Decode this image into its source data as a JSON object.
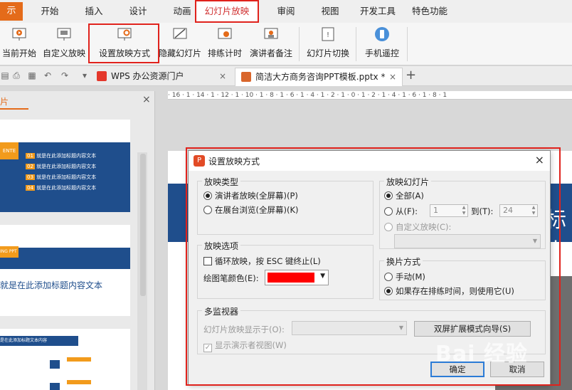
{
  "menu": {
    "file_label": "示",
    "tabs": [
      "开始",
      "插入",
      "设计",
      "动画",
      "幻灯片放映",
      "审阅",
      "视图",
      "开发工具",
      "特色功能"
    ],
    "active_tab": "幻灯片放映"
  },
  "ribbon": {
    "buttons": [
      "当前开始",
      "自定义放映",
      "设置放映方式",
      "隐藏幻灯片",
      "排练计时",
      "演讲者备注",
      "幻灯片切换",
      "手机遥控"
    ]
  },
  "docbar": {
    "tab_portal": "WPS 办公资源门户",
    "tab_doc": "简洁大方商务咨询PPT模板.pptx *",
    "new_tab": "+"
  },
  "leftpane": {
    "header": "片",
    "slide1": {
      "tag": "ENTE",
      "items": [
        {
          "num": "01",
          "text": "就是在此添加标题内容文本"
        },
        {
          "num": "02",
          "text": "就是在此添加标题内容文本"
        },
        {
          "num": "03",
          "text": "就是在此添加标题内容文本"
        },
        {
          "num": "04",
          "text": "就是在此添加标题内容文本"
        }
      ]
    },
    "slide2": {
      "tag": "ING PPT",
      "text": "就是在此添加标题内容文本"
    },
    "slide3": {
      "text": "是在此添加标题文本内容"
    }
  },
  "ruler": {
    "ticks": "· 16 · 1 · 14 · 1 · 12 · 1 · 10 · 1 · 8 · 1 · 6 · 1 · 4 · 1 · 2 · 1 · 0 · 1 · 2 · 1 · 4 · 1 · 6 · 1 · 8 · 1"
  },
  "canvas": {
    "text_fragment": "标内"
  },
  "dialog": {
    "title": "设置放映方式",
    "show_type": {
      "label": "放映类型",
      "opt_presenter": "演讲者放映(全屏幕)(P)",
      "opt_kiosk": "在展台浏览(全屏幕)(K)"
    },
    "show_options": {
      "label": "放映选项",
      "loop": "循环放映，按 ESC 键终止(L)",
      "pen_color_label": "绘图笔颜色(E):",
      "pen_color": "#ff0000"
    },
    "slides": {
      "label": "放映幻灯片",
      "all": "全部(A)",
      "from": "从(F):",
      "from_value": "1",
      "to": "到(T):",
      "to_value": "24",
      "custom": "自定义放映(C):"
    },
    "advance": {
      "label": "换片方式",
      "manual": "手动(M)",
      "timings": "如果存在排练时间，则使用它(U)"
    },
    "monitors": {
      "label": "多监视器",
      "display_on": "幻灯片放映显示于(O):",
      "wizard_button": "双屏扩展模式向导(S)",
      "presenter_view": "显示演示者视图(W)"
    },
    "ok": "确定",
    "cancel": "取消"
  },
  "watermark": "Bai 经验",
  "colors": {
    "accent": "#e0221c",
    "file_orange": "#e46b1a",
    "slide_blue": "#1f4e8c",
    "slide_orange": "#f29b1c"
  }
}
